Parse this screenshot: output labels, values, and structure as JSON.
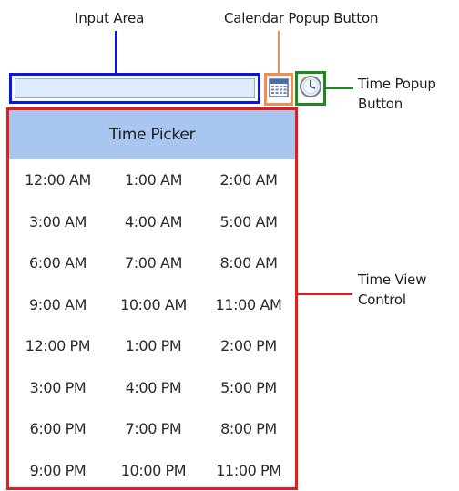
{
  "labels": {
    "input_area": "Input Area",
    "calendar_popup_button": "Calendar Popup Button",
    "time_popup_button_line1": "Time Popup",
    "time_popup_button_line2": "Button",
    "time_view_control_line1": "Time View",
    "time_view_control_line2": "Control"
  },
  "time_picker": {
    "header": "Time Picker",
    "times": [
      "12:00 AM",
      "1:00 AM",
      "2:00 AM",
      "3:00 AM",
      "4:00 AM",
      "5:00 AM",
      "6:00 AM",
      "7:00 AM",
      "8:00 AM",
      "9:00 AM",
      "10:00 AM",
      "11:00 AM",
      "12:00 PM",
      "1:00 PM",
      "2:00 PM",
      "3:00 PM",
      "4:00 PM",
      "5:00 PM",
      "6:00 PM",
      "7:00 PM",
      "8:00 PM",
      "9:00 PM",
      "10:00 PM",
      "11:00 PM"
    ]
  },
  "colors": {
    "input_area_outline": "#0a14e6",
    "calendar_button_outline": "#f08d50",
    "time_button_outline": "#1c8a1c",
    "time_view_outline": "#e51b1b",
    "header_background": "#a9c6f1",
    "input_background": "#ddebfb"
  },
  "icons": {
    "calendar_button": "calendar-icon",
    "time_button": "clock-icon"
  }
}
